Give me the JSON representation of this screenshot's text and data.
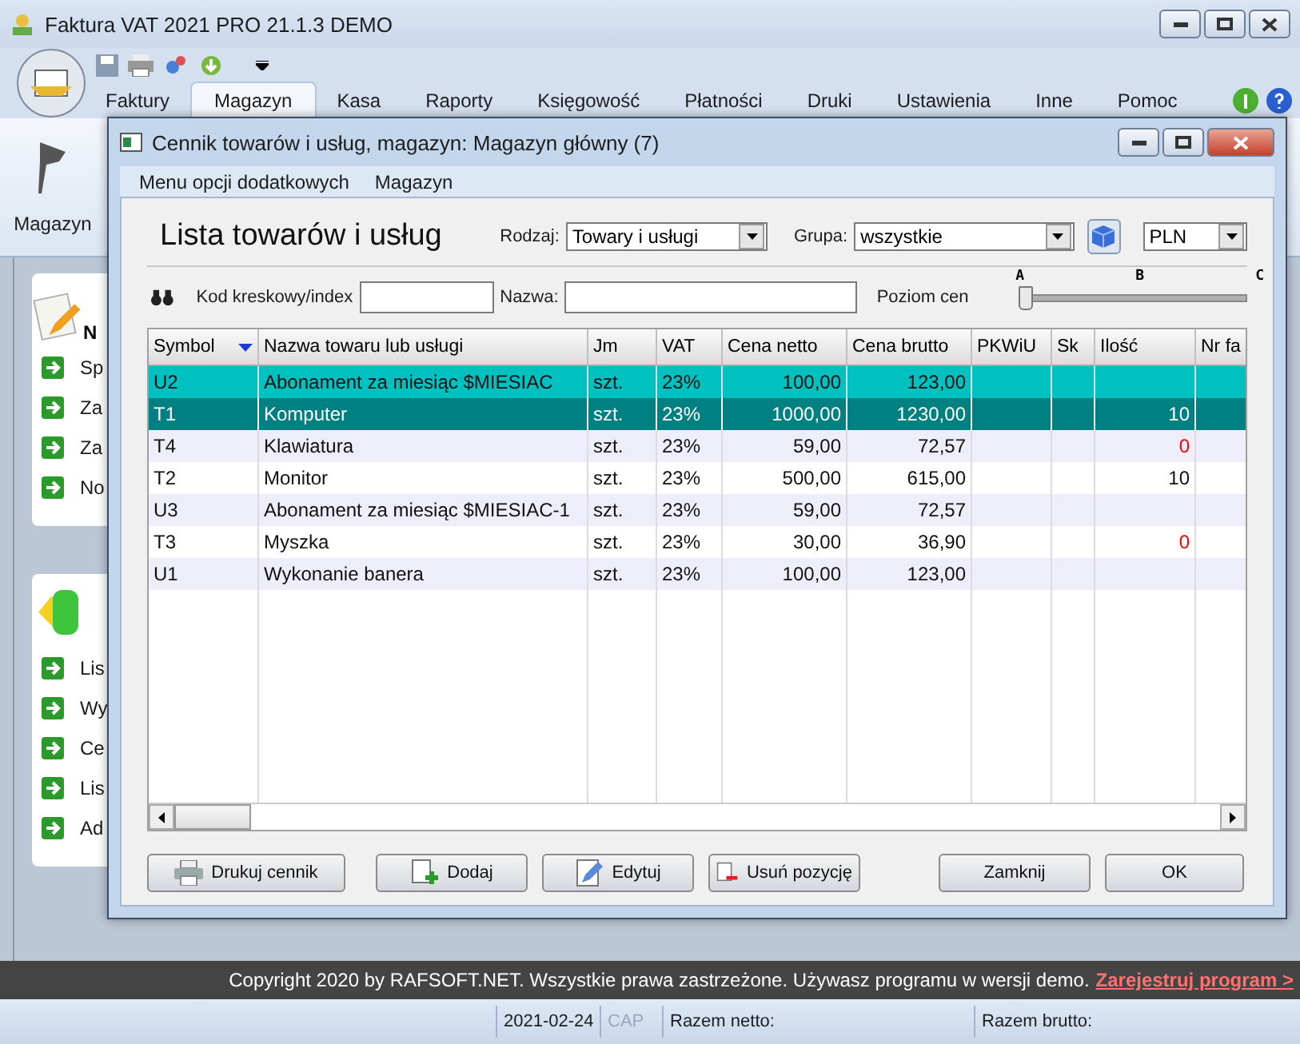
{
  "window": {
    "title": "Faktura VAT 2021 PRO 21.1.3 DEMO"
  },
  "ribbon_tabs": [
    {
      "label": "Faktury",
      "selected": false
    },
    {
      "label": "Magazyn",
      "selected": true
    },
    {
      "label": "Kasa",
      "selected": false
    },
    {
      "label": "Raporty",
      "selected": false
    },
    {
      "label": "Księgowość",
      "selected": false
    },
    {
      "label": "Płatności",
      "selected": false
    },
    {
      "label": "Druki",
      "selected": false
    },
    {
      "label": "Ustawienia",
      "selected": false
    },
    {
      "label": "Inne",
      "selected": false
    },
    {
      "label": "Pomoc",
      "selected": false
    }
  ],
  "ribbon_button": "Magazyn",
  "side_panels": [
    {
      "heading": "N",
      "items": [
        "Sp",
        "Za",
        "Za",
        "No"
      ]
    },
    {
      "items": [
        "Lis",
        "Wy",
        "Ce",
        "Lis",
        "Ad"
      ]
    }
  ],
  "dialog": {
    "title": "Cennik towarów i usług, magazyn: Magazyn główny (7)",
    "menu": [
      "Menu opcji dodatkowych",
      "Magazyn"
    ],
    "heading": "Lista towarów i usług",
    "rodzaj": {
      "label": "Rodzaj:",
      "value": "Towary i usługi"
    },
    "grupa": {
      "label": "Grupa:",
      "value": "wszystkie"
    },
    "currency": "PLN",
    "barcode_label": "Kod kreskowy/index",
    "name_label": "Nazwa:",
    "price_level": {
      "label": "Poziom cen",
      "ticks": [
        "A",
        "B",
        "C"
      ],
      "level": 0
    },
    "columns": [
      "Symbol",
      "Nazwa towaru lub usługi",
      "Jm",
      "VAT",
      "Cena netto",
      "Cena brutto",
      "PKWiU",
      "Sk",
      "Ilość",
      "Nr fa"
    ],
    "rows": [
      {
        "cells": [
          "U2",
          "Abonament za miesiąc $MIESIAC",
          "szt.",
          "23%",
          "100,00",
          "123,00",
          "",
          "",
          "",
          ""
        ],
        "selected": false,
        "marked": true
      },
      {
        "cells": [
          "T1",
          "Komputer",
          "szt.",
          "23%",
          "1000,00",
          "1230,00",
          "",
          "",
          "10",
          ""
        ],
        "selected": true,
        "marked": false,
        "quantity_low": false
      },
      {
        "cells": [
          "T4",
          "Klawiatura",
          "szt.",
          "23%",
          "59,00",
          "72,57",
          "",
          "",
          "0",
          ""
        ],
        "selected": false,
        "marked": false,
        "quantity_low": true
      },
      {
        "cells": [
          "T2",
          "Monitor",
          "szt.",
          "23%",
          "500,00",
          "615,00",
          "",
          "",
          "10",
          ""
        ],
        "selected": false,
        "marked": false,
        "quantity_low": false
      },
      {
        "cells": [
          "U3",
          "Abonament za miesiąc $MIESIAC-1",
          "szt.",
          "23%",
          "59,00",
          "72,57",
          "",
          "",
          "",
          ""
        ],
        "selected": false,
        "marked": false
      },
      {
        "cells": [
          "T3",
          "Myszka",
          "szt.",
          "23%",
          "30,00",
          "36,90",
          "",
          "",
          "0",
          ""
        ],
        "selected": false,
        "marked": false,
        "quantity_low": true
      },
      {
        "cells": [
          "U1",
          "Wykonanie banera",
          "szt.",
          "23%",
          "100,00",
          "123,00",
          "",
          "",
          "",
          ""
        ],
        "selected": false,
        "marked": false
      }
    ],
    "buttons": [
      {
        "label": "Drukuj cennik",
        "kind": "print"
      },
      {
        "label": "Dodaj",
        "kind": "add"
      },
      {
        "label": "Edytuj",
        "kind": "edit"
      },
      {
        "label": "Usuń pozycję",
        "kind": "delete"
      },
      {
        "label": "Zamknij",
        "kind": "plain"
      },
      {
        "label": "OK",
        "kind": "plain"
      }
    ]
  },
  "footer": {
    "copyright": "Copyright 2020 by RAFSOFT.NET. Wszystkie prawa zastrzeżone. Używasz programu w wersji demo.",
    "link": "Zarejestruj program >"
  },
  "status_bar": {
    "date": "2021-02-24",
    "caps": {
      "label": "CAP",
      "on": false
    },
    "net_total": "Razem netto:",
    "gross_total": "Razem brutto:"
  }
}
